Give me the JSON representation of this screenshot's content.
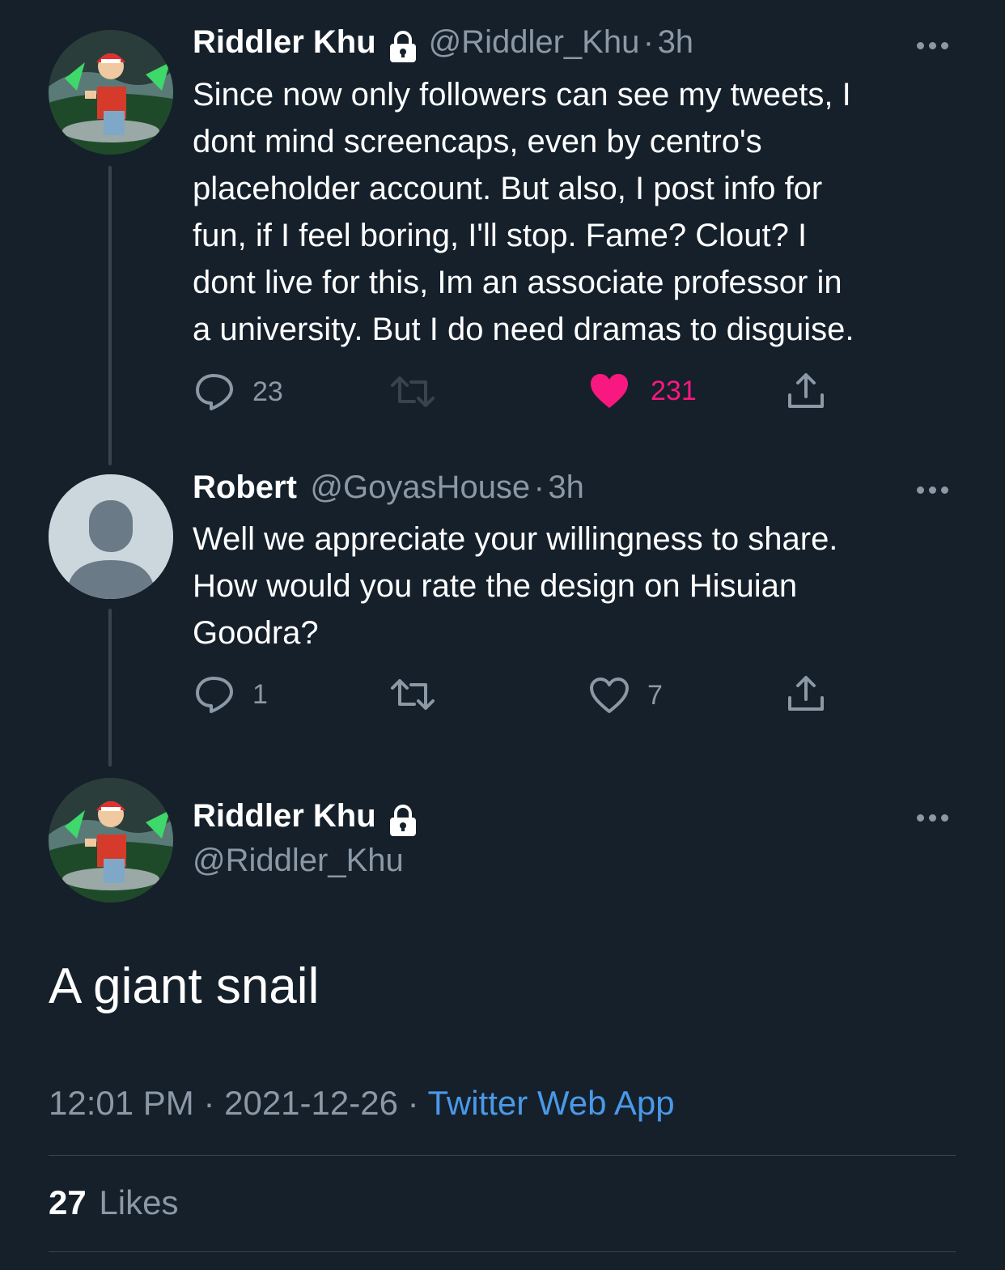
{
  "tweet1": {
    "author_name": "Riddler Khu",
    "handle": "@Riddler_Khu",
    "time": "3h",
    "text_lines": [
      "Since now only followers can see my tweets, I",
      "dont mind screencaps, even by centro's",
      "placeholder account. But also, I post info for",
      "fun, if I feel boring, I'll stop. Fame? Clout? I",
      "dont live for this, Im an associate professor in",
      "a university. But I do need dramas to disguise."
    ],
    "replies": "23",
    "likes": "231",
    "liked": true
  },
  "tweet2": {
    "author_name": "Robert",
    "handle": "@GoyasHouse",
    "time": "3h",
    "text_lines": [
      "Well we appreciate your willingness to share.",
      "How would you rate the design on Hisuian",
      "Goodra?"
    ],
    "replies": "1",
    "likes": "7"
  },
  "main_tweet": {
    "author_name": "Riddler Khu",
    "handle": "@Riddler_Khu",
    "text": "A giant snail",
    "time": "12:01 PM",
    "date": "2021-12-26",
    "source": "Twitter Web App",
    "likes_count": "27",
    "likes_label": "Likes"
  },
  "colors": {
    "background": "#15202b",
    "like_pink": "#f91880",
    "link_blue": "#4a99e9",
    "muted": "#8b98a5"
  }
}
